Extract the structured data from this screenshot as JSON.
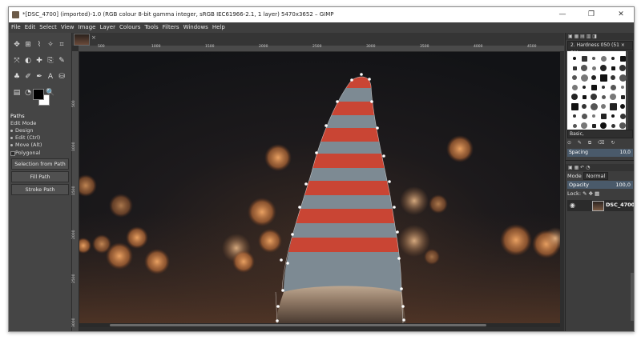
{
  "window": {
    "title": "*[DSC_4700] (imported)-1.0 (RGB colour 8-bit gamma integer, sRGB IEC61966-2.1, 1 layer) 5470x3652 – GIMP",
    "minimize": "—",
    "maximize": "❐",
    "close": "✕"
  },
  "menu": [
    "File",
    "Edit",
    "Select",
    "View",
    "Image",
    "Layer",
    "Colours",
    "Tools",
    "Filters",
    "Windows",
    "Help"
  ],
  "tools": {
    "icons": [
      "move-icon",
      "align-icon",
      "free-select-icon",
      "fuzzy-select-icon",
      "crop-icon",
      "transform-icon",
      "warp-icon",
      "heal-icon",
      "clone-icon",
      "smudge-icon",
      "paint-icon",
      "brush-icon",
      "path-icon",
      "text-icon",
      "fill-icon",
      "gradient-icon",
      "dodge-icon",
      "eyedropper-icon",
      "zoom-icon"
    ],
    "glyphs": [
      "✥",
      "⊞",
      "⌇",
      "✧",
      "⌗",
      "⤧",
      "◐",
      "✚",
      "⎘",
      "✎",
      "♣",
      "✐",
      "✒",
      "A",
      "⛁",
      "▤",
      "◔",
      "✍",
      "🔍"
    ]
  },
  "tool_options": {
    "title": "Paths",
    "edit_mode_label": "Edit Mode",
    "modes": [
      "Design",
      "Edit (Ctrl)",
      "Move (Alt)"
    ],
    "polygonal": "Polygonal",
    "buttons": [
      "Selection from Path",
      "Fill Path",
      "Stroke Path"
    ]
  },
  "canvas": {
    "close_glyph": "×",
    "ruler_labels": [
      "500",
      "1000",
      "1500",
      "2000",
      "2500",
      "3000",
      "3500",
      "4000",
      "4500"
    ],
    "vruler_labels": [
      "500",
      "1000",
      "1500",
      "2000",
      "2500",
      "3000"
    ]
  },
  "brushes": {
    "current": "2. Hardness 050 (51 × 51)",
    "tag_field": "Basic,",
    "spacing_label": "Spacing",
    "spacing_value": "10,0",
    "action_icons": "⊙ ✎ ⧉ ⌫ ↻"
  },
  "layers": {
    "mode_label": "Mode",
    "mode_value": "Normal",
    "opacity_label": "Opacity",
    "opacity_value": "100,0",
    "lock_label": "Lock:",
    "lock_icons": "✎ ✥ ▦",
    "layer_name": "DSC_4700"
  },
  "colors": {
    "canvas_bg": "#2e2e2e",
    "panel_bg": "#454545",
    "hat_red": "#c94534",
    "hat_grey": "#7d8a93",
    "path_anchor": "#ffffff"
  }
}
